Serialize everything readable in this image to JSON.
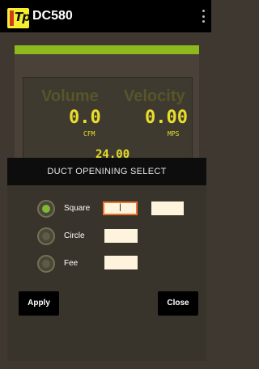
{
  "app": {
    "logo_text": "Tpi",
    "title": "DC580"
  },
  "readout": {
    "volume_label": "Volume",
    "velocity_label": "Velocity",
    "volume_value": "0.0",
    "volume_unit": "CFM",
    "velocity_value": "0.00",
    "velocity_unit": "MPS",
    "partial_value": "24.00"
  },
  "dialog": {
    "title": "DUCT OPENINING SELECT",
    "options": [
      {
        "label": "Square",
        "selected": true
      },
      {
        "label": "Circle",
        "selected": false
      },
      {
        "label": "Fee",
        "selected": false
      }
    ],
    "square_width_value": "|",
    "apply_label": "Apply",
    "close_label": "Close"
  },
  "colors": {
    "accent_green": "#8bb91e",
    "display_yellow": "#e8de2a",
    "active_field_border": "#e9742a"
  }
}
